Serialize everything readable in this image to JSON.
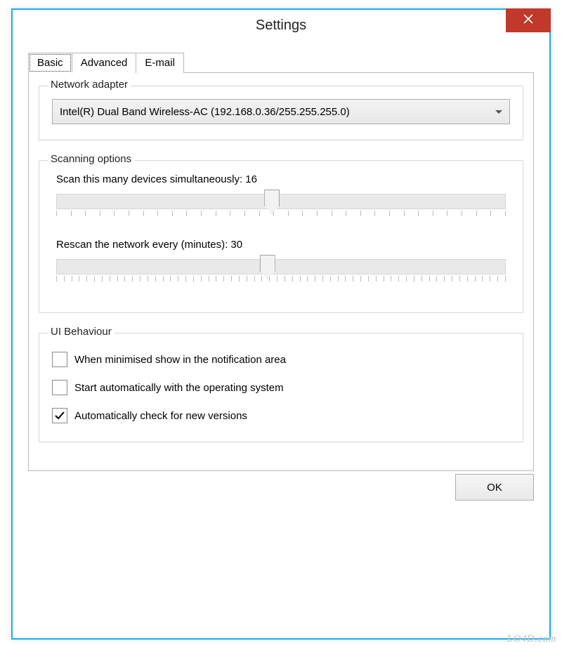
{
  "window": {
    "title": "Settings"
  },
  "tabs": {
    "basic": "Basic",
    "advanced": "Advanced",
    "email": "E-mail"
  },
  "network_adapter": {
    "legend": "Network adapter",
    "selected": "Intel(R) Dual Band Wireless-AC (192.168.0.36/255.255.255.0)"
  },
  "scanning": {
    "legend": "Scanning options",
    "simultaneous_label": "Scan this many devices simultaneously: 16",
    "simultaneous_value": 16,
    "rescan_label": "Rescan the network every (minutes): 30",
    "rescan_value": 30
  },
  "ui_behaviour": {
    "legend": "UI Behaviour",
    "minimised_label": "When minimised show in the notification area",
    "minimised_checked": false,
    "autostart_label": "Start automatically with the operating system",
    "autostart_checked": false,
    "autocheck_label": "Automatically check for new versions",
    "autocheck_checked": true
  },
  "buttons": {
    "ok": "OK"
  },
  "watermark": "LO4D.com"
}
